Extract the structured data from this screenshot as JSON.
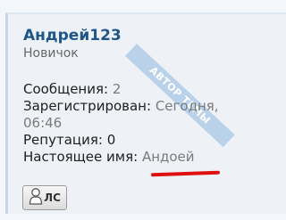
{
  "user": {
    "name": "Андрей123",
    "rank": "Новичок"
  },
  "badge": "АВТОР ТЕМЫ",
  "info": {
    "messages_label": "Сообщения:",
    "messages_value": "2",
    "registered_label": "Зарегистрирован:",
    "registered_value_line1": "Сегодня,",
    "registered_value_line2": "06:46",
    "reputation_label": "Репутация:",
    "reputation_value": "0",
    "realname_label": "Настоящее имя:",
    "realname_value": "Андоей"
  },
  "pm_button": {
    "label": "ЛС"
  },
  "colors": {
    "username": "#1f5587",
    "ribbon": "#b9d2ea",
    "annotation": "#e01010"
  },
  "icons": {
    "pm": "user-icon"
  }
}
